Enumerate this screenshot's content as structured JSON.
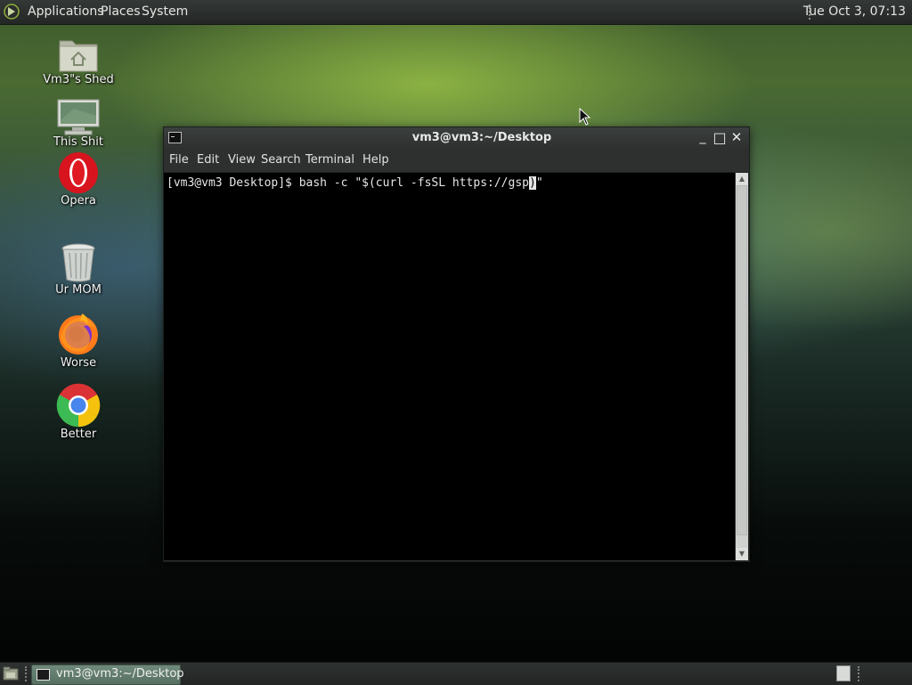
{
  "top_panel": {
    "menus": [
      "Applications",
      "Places",
      "System"
    ],
    "clock": "Tue Oct  3, 07:13"
  },
  "desktop_icons": [
    {
      "label": "Vm3\"s Shed",
      "icon": "home-folder-icon"
    },
    {
      "label": "This Shit",
      "icon": "computer-icon"
    },
    {
      "label": "Opera",
      "icon": "opera-icon"
    },
    {
      "label": "Ur MOM",
      "icon": "trash-icon"
    },
    {
      "label": "Worse",
      "icon": "firefox-icon"
    },
    {
      "label": "Better",
      "icon": "chrome-icon"
    }
  ],
  "terminal": {
    "title": "vm3@vm3:~/Desktop",
    "menu": [
      "File",
      "Edit",
      "View",
      "Search",
      "Terminal",
      "Help"
    ],
    "line_before_cursor": "[vm3@vm3 Desktop]$ bash -c \"$(curl -fsSL https://gsp",
    "cursor_char": ")",
    "line_after_cursor": "\"",
    "controls": {
      "minimize": "_",
      "maximize": "□",
      "close": "✕"
    }
  },
  "bottom_panel": {
    "task_label": "vm3@vm3:~/Desktop"
  },
  "colors": {
    "panel": "#2a2d2b",
    "terminal_bg": "#000000",
    "terminal_fg": "#e6e6e6",
    "task_button": "#627d6e"
  }
}
